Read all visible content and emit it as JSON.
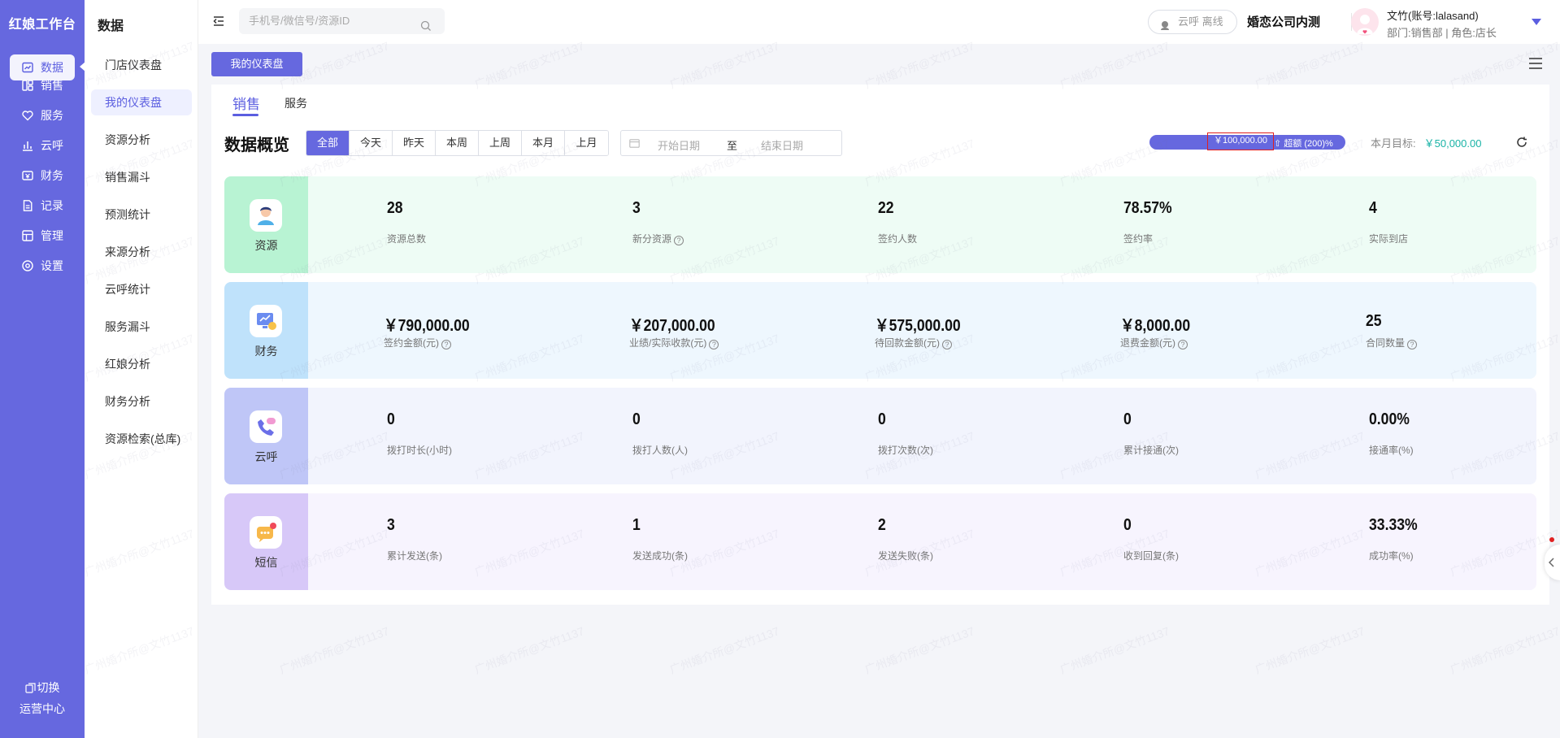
{
  "app": {
    "brand": "红娘工作台"
  },
  "rail": {
    "items": [
      {
        "label": "数据",
        "icon": "chart-icon"
      },
      {
        "label": "销售",
        "icon": "grid-icon"
      },
      {
        "label": "服务",
        "icon": "heart-icon"
      },
      {
        "label": "云呼",
        "icon": "bar-icon"
      },
      {
        "label": "财务",
        "icon": "wallet-icon"
      },
      {
        "label": "记录",
        "icon": "doc-icon"
      },
      {
        "label": "管理",
        "icon": "manage-icon"
      },
      {
        "label": "设置",
        "icon": "settings-icon"
      }
    ],
    "switch_line1": "切换",
    "switch_line2": "运营中心"
  },
  "submenu": {
    "title": "数据",
    "items": [
      "门店仪表盘",
      "我的仪表盘",
      "资源分析",
      "销售漏斗",
      "预测统计",
      "来源分析",
      "云呼统计",
      "服务漏斗",
      "红娘分析",
      "财务分析",
      "资源检索(总库)"
    ]
  },
  "topbar": {
    "search_placeholder": "手机号/微信号/资源ID",
    "cloud_status": "云呼 离线",
    "company": "婚恋公司内测",
    "user_name": "文竹(账号:lalasand)",
    "user_dept": "部门:销售部  |  角色:店长"
  },
  "tag": "我的仪表盘",
  "tabs": [
    "销售",
    "服务"
  ],
  "overview": {
    "title": "数据概览",
    "ranges": [
      "全部",
      "今天",
      "昨天",
      "本周",
      "上周",
      "本月",
      "上月"
    ],
    "date_start": "开始日期",
    "date_sep": "至",
    "date_end": "结束日期",
    "progress_value": "￥100,000.00",
    "progress_over": "超额 (200)%",
    "progress_percent": 200,
    "goal_label": "本月目标:",
    "goal_value": "￥50,000.00"
  },
  "cards": [
    {
      "name": "资源",
      "color": "#b8f3d3",
      "bg": "#eefcf5",
      "stats": [
        {
          "value": "28",
          "label": "资源总数",
          "help": false
        },
        {
          "value": "3",
          "label": "新分资源",
          "help": true
        },
        {
          "value": "22",
          "label": "签约人数",
          "help": false
        },
        {
          "value": "78.57%",
          "label": "签约率",
          "help": false
        },
        {
          "value": "4",
          "label": "实际到店",
          "help": false
        }
      ]
    },
    {
      "name": "财务",
      "color": "#bfe2fb",
      "bg": "#eef7fe",
      "stats": [
        {
          "value": "￥790,000.00",
          "label": "签约金额(元)",
          "help": true
        },
        {
          "value": "￥207,000.00",
          "label": "业绩/实际收款(元)",
          "help": true
        },
        {
          "value": "￥575,000.00",
          "label": "待回款金额(元)",
          "help": true
        },
        {
          "value": "￥8,000.00",
          "label": "退费金额(元)",
          "help": true
        },
        {
          "value": "25",
          "label": "合同数量",
          "help": true
        }
      ]
    },
    {
      "name": "云呼",
      "color": "#bfc6f7",
      "bg": "#f2f4fd",
      "stats": [
        {
          "value": "0",
          "label": "拨打时长(小时)",
          "help": false
        },
        {
          "value": "0",
          "label": "拨打人数(人)",
          "help": false
        },
        {
          "value": "0",
          "label": "拨打次数(次)",
          "help": false
        },
        {
          "value": "0",
          "label": "累计接通(次)",
          "help": false
        },
        {
          "value": "0.00%",
          "label": "接通率(%)",
          "help": false
        }
      ]
    },
    {
      "name": "短信",
      "color": "#d7c8f8",
      "bg": "#f7f4fe",
      "stats": [
        {
          "value": "3",
          "label": "累计发送(条)",
          "help": false
        },
        {
          "value": "1",
          "label": "发送成功(条)",
          "help": false
        },
        {
          "value": "2",
          "label": "发送失败(条)",
          "help": false
        },
        {
          "value": "0",
          "label": "收到回复(条)",
          "help": false
        },
        {
          "value": "33.33%",
          "label": "成功率(%)",
          "help": false
        }
      ]
    }
  ],
  "watermark": "广州婚介所@文竹1137"
}
